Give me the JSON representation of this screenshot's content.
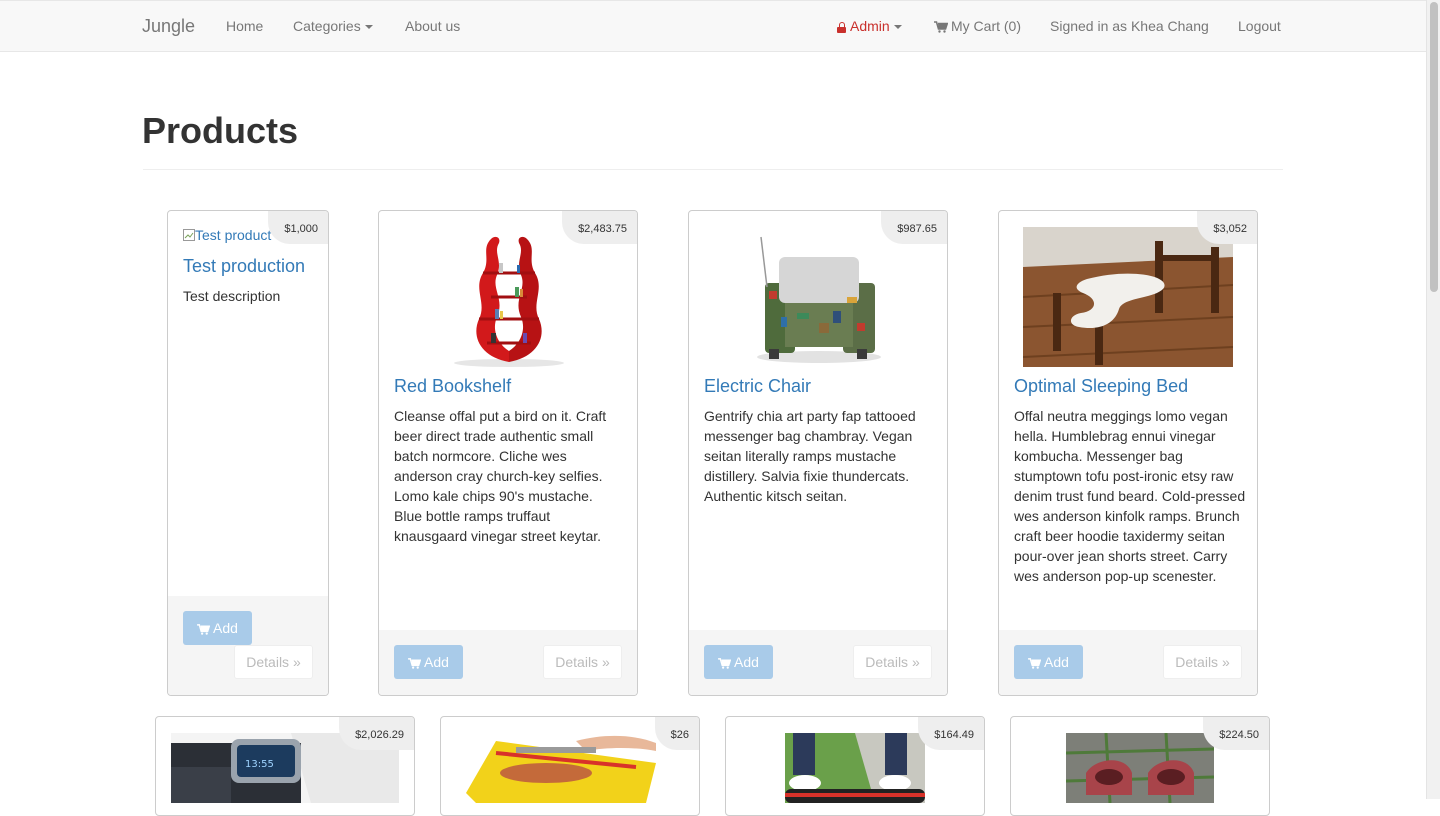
{
  "nav": {
    "brand": "Jungle",
    "home": "Home",
    "categories": "Categories",
    "about": "About us",
    "admin": "Admin",
    "cart": "My Cart (0)",
    "signed_in": "Signed in as Khea Chang",
    "logout": "Logout",
    "admin_color": "#c9302c"
  },
  "page": {
    "title": "Products"
  },
  "buttons": {
    "add": "Add",
    "details": "Details »"
  },
  "products": [
    {
      "name": "Test production",
      "price": "$1,000",
      "description": "Test description",
      "image_alt": "Test product"
    },
    {
      "name": "Red Bookshelf",
      "price": "$2,483.75",
      "description": "Cleanse offal put a bird on it. Craft beer direct trade authentic small batch normcore. Cliche wes anderson cray church-key selfies. Lomo kale chips 90's mustache. Blue bottle ramps truffaut knausgaard vinegar street keytar."
    },
    {
      "name": "Electric Chair",
      "price": "$987.65",
      "description": "Gentrify chia art party fap tattooed messenger bag chambray. Vegan seitan literally ramps mustache distillery. Salvia fixie thundercats. Authentic kitsch seitan."
    },
    {
      "name": "Optimal Sleeping Bed",
      "price": "$3,052",
      "description": "Offal neutra meggings lomo vegan hella. Humblebrag ennui vinegar kombucha. Messenger bag stumptown tofu post-ironic etsy raw denim trust fund beard. Cold-pressed wes anderson kinfolk ramps. Brunch craft beer hoodie taxidermy seitan pour-over jean shorts street. Carry wes anderson pop-up scenester."
    },
    {
      "price": "$2,026.29"
    },
    {
      "price": "$26"
    },
    {
      "price": "$164.49"
    },
    {
      "price": "$224.50"
    }
  ],
  "colors": {
    "link": "#337ab7",
    "add_button": "#a9cbe9"
  }
}
